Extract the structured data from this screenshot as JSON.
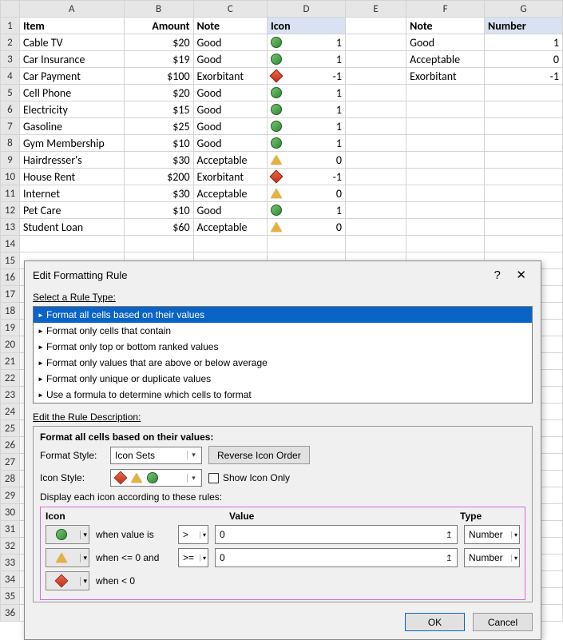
{
  "cols": [
    "A",
    "B",
    "C",
    "D",
    "E",
    "F",
    "G"
  ],
  "headers": {
    "A": "Item",
    "B": "Amount",
    "C": "Note",
    "D": "Icon",
    "F": "Note",
    "G": "Number"
  },
  "rows": [
    {
      "n": 1,
      "A": "Item",
      "B": "Amount",
      "C": "Note",
      "D": "Icon",
      "F": "Note",
      "G": "Number",
      "hdr": true
    },
    {
      "n": 2,
      "A": "Cable TV",
      "B": "$20",
      "C": "Good",
      "Dicon": "circle",
      "Dv": "1",
      "F": "Good",
      "G": "1"
    },
    {
      "n": 3,
      "A": "Car Insurance",
      "B": "$19",
      "C": "Good",
      "Dicon": "circle",
      "Dv": "1",
      "F": "Acceptable",
      "G": "0"
    },
    {
      "n": 4,
      "A": "Car Payment",
      "B": "$100",
      "C": "Exorbitant",
      "Dicon": "diam",
      "Dv": "-1",
      "F": "Exorbitant",
      "G": "-1"
    },
    {
      "n": 5,
      "A": "Cell Phone",
      "B": "$20",
      "C": "Good",
      "Dicon": "circle",
      "Dv": "1"
    },
    {
      "n": 6,
      "A": "Electricity",
      "B": "$15",
      "C": "Good",
      "Dicon": "circle",
      "Dv": "1"
    },
    {
      "n": 7,
      "A": "Gasoline",
      "B": "$25",
      "C": "Good",
      "Dicon": "circle",
      "Dv": "1"
    },
    {
      "n": 8,
      "A": "Gym Membership",
      "B": "$10",
      "C": "Good",
      "Dicon": "circle",
      "Dv": "1"
    },
    {
      "n": 9,
      "A": "Hairdresser's",
      "B": "$30",
      "C": "Acceptable",
      "Dicon": "tri",
      "Dv": "0"
    },
    {
      "n": 10,
      "A": "House Rent",
      "B": "$200",
      "C": "Exorbitant",
      "Dicon": "diam",
      "Dv": "-1"
    },
    {
      "n": 11,
      "A": "Internet",
      "B": "$30",
      "C": "Acceptable",
      "Dicon": "tri",
      "Dv": "0"
    },
    {
      "n": 12,
      "A": "Pet Care",
      "B": "$10",
      "C": "Good",
      "Dicon": "circle",
      "Dv": "1"
    },
    {
      "n": 13,
      "A": "Student Loan",
      "B": "$60",
      "C": "Acceptable",
      "Dicon": "tri",
      "Dv": "0"
    }
  ],
  "emptyRows": 23,
  "dialog": {
    "title": "Edit Formatting Rule",
    "ruleTypeLbl": "Select a Rule Type:",
    "ruleTypes": [
      "Format all cells based on their values",
      "Format only cells that contain",
      "Format only top or bottom ranked values",
      "Format only values that are above or below average",
      "Format only unique or duplicate values",
      "Use a formula to determine which cells to format"
    ],
    "ruleDescLbl": "Edit the Rule Description:",
    "descHeader": "Format all cells based on their values:",
    "formatStyleLbl": "Format Style:",
    "formatStyleVal": "Icon Sets",
    "reverseBtn": "Reverse Icon Order",
    "iconStyleLbl": "Icon Style:",
    "showIconOnly": "Show Icon Only",
    "displayLbl": "Display each icon according to these rules:",
    "gridCols": {
      "c1": "Icon",
      "c2": "",
      "c3": "Value",
      "c4": "Type"
    },
    "rules": [
      {
        "icon": "circle",
        "when": "when value is",
        "op": ">",
        "val": "0",
        "type": "Number"
      },
      {
        "icon": "tri",
        "when": "when <= 0 and",
        "op": ">=",
        "val": "0",
        "type": "Number"
      },
      {
        "icon": "diam",
        "when": "when < 0"
      }
    ],
    "ok": "OK",
    "cancel": "Cancel"
  }
}
